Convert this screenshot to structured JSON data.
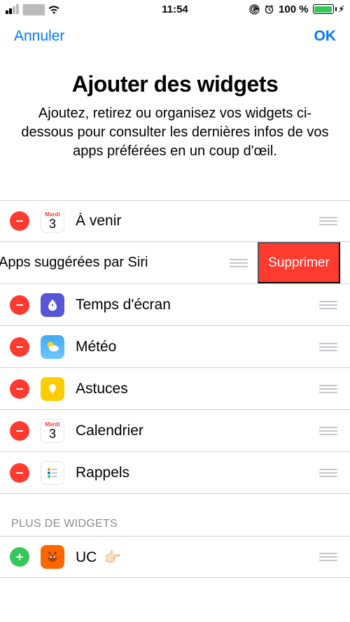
{
  "status": {
    "carrier_redacted": "▇▇▇",
    "time": "11:54",
    "battery_pct": "100 %"
  },
  "nav": {
    "cancel": "Annuler",
    "ok": "OK"
  },
  "header": {
    "title": "Ajouter des widgets",
    "description": "Ajoutez, retirez ou organisez vos widgets ci-dessous pour consulter les dernières infos de vos apps préférées en un coup d'œil."
  },
  "active_widgets": {
    "calendar_dow": "Mardi",
    "calendar_day": "3",
    "items": [
      {
        "label": "À venir"
      },
      {
        "label": "Apps suggérées par Siri"
      },
      {
        "label": "Temps d'écran"
      },
      {
        "label": "Météo"
      },
      {
        "label": "Astuces"
      },
      {
        "label": "Calendrier"
      },
      {
        "label": "Rappels"
      }
    ],
    "delete_action": "Supprimer"
  },
  "more_section": {
    "title": "PLUS DE WIDGETS",
    "items": [
      {
        "label": "UC",
        "pointer": "👉🏻"
      }
    ]
  }
}
